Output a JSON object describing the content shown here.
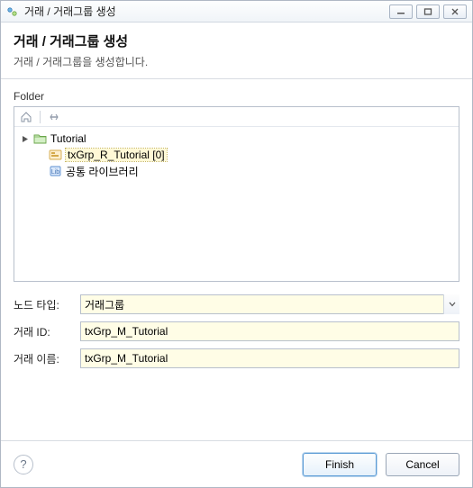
{
  "window": {
    "title": "거래 / 거래그룹 생성"
  },
  "header": {
    "title": "거래 / 거래그룹 생성",
    "subtitle": "거래 / 거래그룹을 생성합니다."
  },
  "folder": {
    "label": "Folder",
    "tree": {
      "root": {
        "label": "Tutorial"
      },
      "child1": {
        "label": "txGrp_R_Tutorial [0]"
      },
      "child2": {
        "label": "공통 라이브러리"
      }
    }
  },
  "form": {
    "node_type_label": "노드 타입:",
    "node_type_value": "거래그룹",
    "txn_id_label": "거래 ID:",
    "txn_id_value": "txGrp_M_Tutorial",
    "txn_name_label": "거래 이름:",
    "txn_name_value": "txGrp_M_Tutorial"
  },
  "footer": {
    "finish": "Finish",
    "cancel": "Cancel"
  }
}
